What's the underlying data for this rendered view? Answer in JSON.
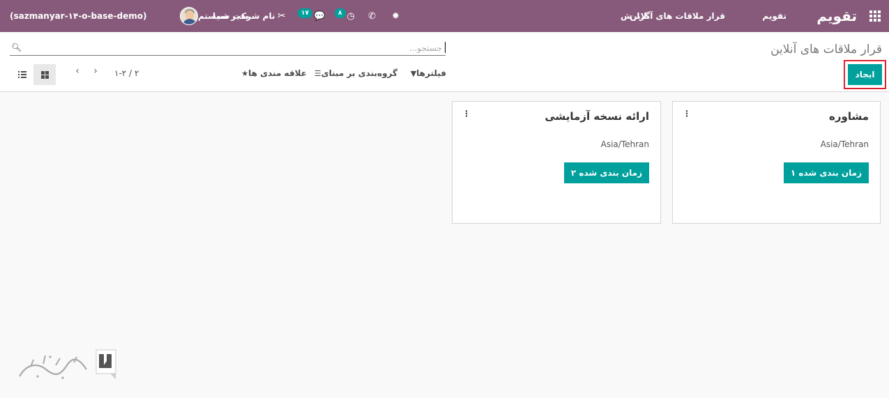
{
  "navbar": {
    "app_title": "تقویم",
    "menus": [
      "تقویم",
      "قرار ملاقات های آنلاین",
      "گزارش"
    ],
    "database": "(sazmanyar-۱۴-o-base-demo)",
    "user_name": "مدیر سیستم",
    "company": "نام شرکت شما",
    "messages_count": "۱۷",
    "activities_count": "۸"
  },
  "control_panel": {
    "title": "قرار ملاقات های آنلاین",
    "search_placeholder": "جستجو...",
    "create_label": "ایجاد",
    "filters_label": "فیلترها",
    "group_by_label": "گروه‌بندی بر مبنای",
    "favorites_label": "علاقه مندی ها",
    "pager_value": "۱-۲ / ۲"
  },
  "cards": [
    {
      "title": "مشاوره",
      "timezone": "Asia/Tehran",
      "button": "۱ زمان بندی شده"
    },
    {
      "title": "ارائه نسخه آزمایشی",
      "timezone": "Asia/Tehran",
      "button": "۲ زمان بندی شده"
    }
  ],
  "colors": {
    "navbar": "#875a7b",
    "accent": "#00a09d",
    "highlight": "#e0202e"
  }
}
